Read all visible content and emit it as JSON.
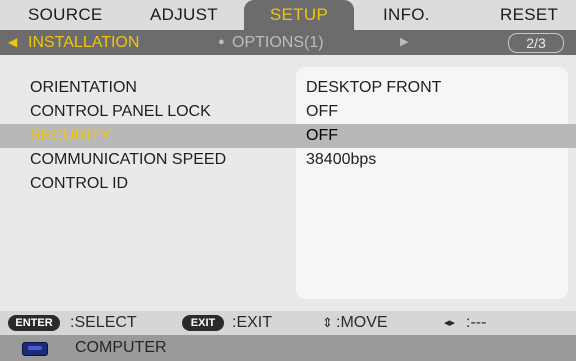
{
  "menu": {
    "tabs": [
      {
        "label": "SOURCE"
      },
      {
        "label": "ADJUST"
      },
      {
        "label": "SETUP"
      },
      {
        "label": "INFO."
      },
      {
        "label": "RESET"
      }
    ],
    "active_tab": "SETUP"
  },
  "subtabs": {
    "left_arrow": "◀",
    "active": "INSTALLATION",
    "bullet": "●",
    "next": "OPTIONS(1)",
    "right_arrow": "▶",
    "page": "2/3"
  },
  "settings": {
    "rows": [
      {
        "label": "ORIENTATION",
        "value": "DESKTOP FRONT"
      },
      {
        "label": "CONTROL PANEL LOCK",
        "value": "OFF"
      },
      {
        "label": "SECURITY",
        "value": "OFF"
      },
      {
        "label": "COMMUNICATION SPEED",
        "value": "38400bps"
      },
      {
        "label": "CONTROL ID",
        "value": ""
      }
    ],
    "selected": "SECURITY"
  },
  "footer": {
    "enter_key": "ENTER",
    "select_label": ":SELECT",
    "exit_key": "EXIT",
    "exit_label": ":EXIT",
    "move_icon": "⇕",
    "move_label": ":MOVE",
    "lr_icon": "◂▸",
    "lr_label": ":---"
  },
  "source": {
    "icon": "computer-icon",
    "label": "COMPUTER"
  },
  "colors": {
    "accent": "#f1c40f",
    "panel_dark": "#6c6c6c",
    "selected_row": "#b8b8b8"
  }
}
